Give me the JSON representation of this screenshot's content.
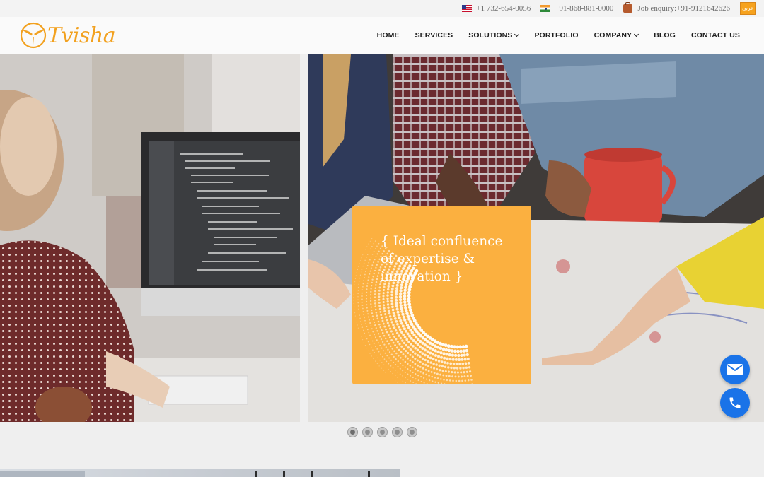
{
  "topbar": {
    "phone_us": "+1 732-654-0056",
    "phone_in": "+91-868-881-0000",
    "job_enquiry": "Job enquiry:+91-9121642626",
    "lang_label": "عربي",
    "icons": [
      "us-flag-icon",
      "india-flag-icon",
      "briefcase-icon"
    ]
  },
  "header": {
    "logo_text": "Tvisha",
    "nav": [
      {
        "label": "HOME"
      },
      {
        "label": "SERVICES"
      },
      {
        "label": "SOLUTIONS",
        "dropdown": true
      },
      {
        "label": "PORTFOLIO"
      },
      {
        "label": "COMPANY",
        "dropdown": true
      },
      {
        "label": "BLOG"
      },
      {
        "label": "CONTACT US"
      }
    ]
  },
  "hero": {
    "caption_line1": "{ Ideal confluence",
    "caption_line2": "of expertise &",
    "caption_line3": "innovation }",
    "slide_count": 5,
    "active_slide": 1
  },
  "floating": {
    "icons": [
      "envelope-icon",
      "phone-icon"
    ]
  },
  "colors": {
    "brand": "#f2a11f",
    "caption_bg": "#fbb040",
    "float_btn": "#1a73e8",
    "lang_btn": "#f6a21e"
  }
}
